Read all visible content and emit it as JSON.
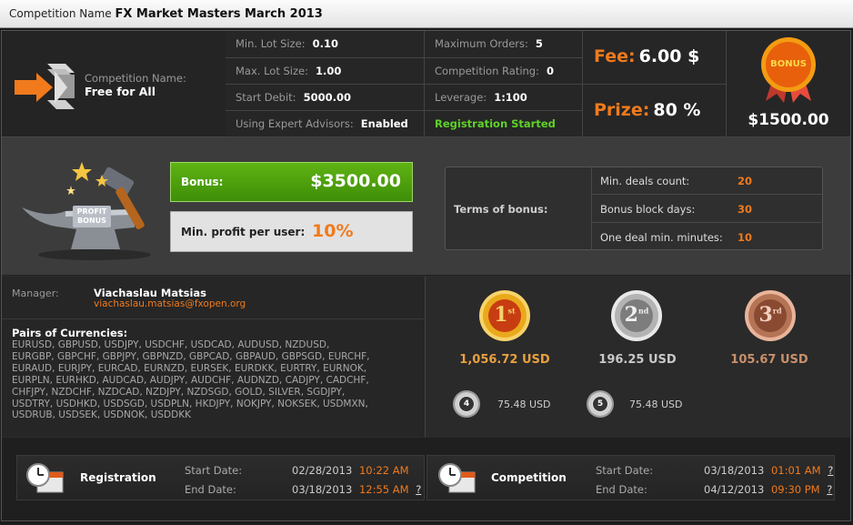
{
  "title_bar": {
    "label": "Competition Name",
    "value": "FX Market Masters March 2013"
  },
  "competition": {
    "name_label": "Competition Name:",
    "name_value": "Free for All"
  },
  "specs_left": [
    {
      "label": "Min. Lot Size:",
      "value": "0.10"
    },
    {
      "label": "Max. Lot Size:",
      "value": "1.00"
    },
    {
      "label": "Start Debit:",
      "value": "5000.00"
    },
    {
      "label": "Using Expert Advisors:",
      "value": "Enabled"
    }
  ],
  "specs_right": [
    {
      "label": "Maximum Orders:",
      "value": "5"
    },
    {
      "label": "Competition Rating:",
      "value": "0"
    },
    {
      "label": "Leverage:",
      "value": "1:100"
    }
  ],
  "registration_status": "Registration Started",
  "fee": {
    "label": "Fee:",
    "value": "6.00 $"
  },
  "prize": {
    "label": "Prize:",
    "value": "80 %"
  },
  "bonus_badge": {
    "text": "BONUS",
    "amount": "$1500.00"
  },
  "profit_bonus_image": {
    "text_line1": "PROFIT",
    "text_line2": "BONUS"
  },
  "bonus_box": {
    "label": "Bonus:",
    "value": "$3500.00"
  },
  "min_profit": {
    "label": "Min. profit per user:",
    "value": "10%"
  },
  "terms": {
    "title": "Terms of bonus:",
    "rows": [
      {
        "label": "Min. deals count:",
        "value": "20"
      },
      {
        "label": "Bonus block days:",
        "value": "30"
      },
      {
        "label": "One deal min. minutes:",
        "value": "10"
      }
    ]
  },
  "manager": {
    "label": "Manager:",
    "name": "Viachaslau Matsias",
    "email": "viachaslau.matsias@fxopen.org"
  },
  "pairs": {
    "title": "Pairs of Currencies:",
    "lines": [
      "EURUSD, GBPUSD, USDJPY, USDCHF, USDCAD, AUDUSD, NZDUSD,",
      "EURGBP, GBPCHF, GBPJPY, GBPNZD, GBPCAD, GBPAUD, GBPSGD, EURCHF,",
      "EURAUD, EURJPY, EURCAD, EURNZD, EURSEK, EURDKK, EURTRY, EURNOK,",
      "EURPLN, EURHKD, AUDCAD, AUDJPY, AUDCHF, AUDNZD, CADJPY, CADCHF,",
      "CHFJPY, NZDCHF, NZDCAD, NZDJPY, NZDSGD, GOLD, SILVER, SGDJPY,",
      "USDTRY, USDHKD, USDSGD, USDPLN, HKDJPY, NOKJPY, NOKSEK, USDMXN,",
      "USDRUB, USDSEK, USDNOK, USDDKK"
    ]
  },
  "prizes": [
    {
      "place": "1",
      "suffix": "st",
      "amount": "1,056.72 USD",
      "color": "#e8a040"
    },
    {
      "place": "2",
      "suffix": "nd",
      "amount": "196.25 USD",
      "color": "#c8c8c8"
    },
    {
      "place": "3",
      "suffix": "rd",
      "amount": "105.67 USD",
      "color": "#c8906a"
    },
    {
      "place": "4",
      "amount": "75.48 USD"
    },
    {
      "place": "5",
      "amount": "75.48 USD"
    }
  ],
  "registration_dates": {
    "title": "Registration",
    "start_label": "Start Date:",
    "start_date": "02/28/2013",
    "start_time": "10:22 AM",
    "end_label": "End Date:",
    "end_date": "03/18/2013",
    "end_time": "12:55 AM",
    "help": "?"
  },
  "competition_dates": {
    "title": "Competition",
    "start_label": "Start Date:",
    "start_date": "03/18/2013",
    "start_time": "01:01 AM",
    "end_label": "End Date:",
    "end_date": "04/12/2013",
    "end_time": "09:30 PM",
    "help": "?"
  }
}
